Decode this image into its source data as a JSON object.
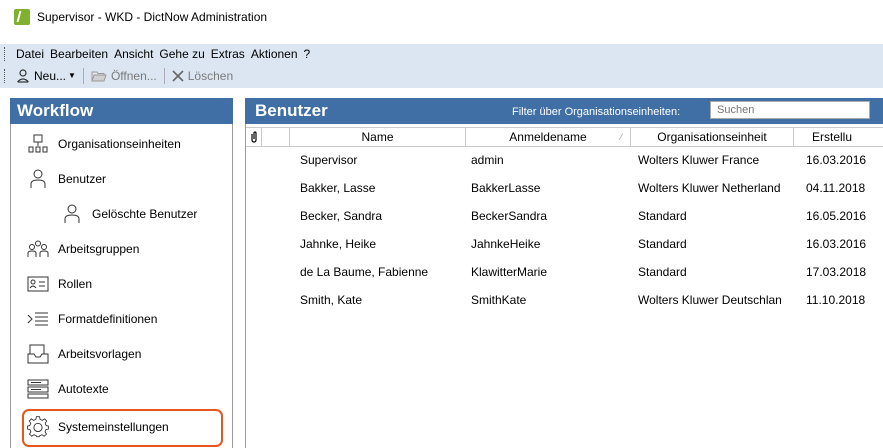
{
  "window": {
    "title": "Supervisor - WKD - DictNow Administration"
  },
  "menu": [
    "Datei",
    "Bearbeiten",
    "Ansicht",
    "Gehe zu",
    "Extras",
    "Aktionen",
    "?"
  ],
  "toolbar": {
    "new_label": "Neu...",
    "open_label": "Öffnen...",
    "delete_label": "Löschen"
  },
  "sidebar": {
    "title": "Workflow",
    "items": [
      {
        "label": "Organisationseinheiten",
        "icon": "org-units-icon"
      },
      {
        "label": "Benutzer",
        "icon": "user-icon"
      },
      {
        "label": "Gelöschte Benutzer",
        "icon": "deleted-user-icon"
      },
      {
        "label": "Arbeitsgruppen",
        "icon": "workgroups-icon"
      },
      {
        "label": "Rollen",
        "icon": "roles-icon"
      },
      {
        "label": "Formatdefinitionen",
        "icon": "format-definitions-icon"
      },
      {
        "label": "Arbeitsvorlagen",
        "icon": "work-templates-icon"
      },
      {
        "label": "Autotexte",
        "icon": "autotext-icon"
      },
      {
        "label": "Systemeinstellungen",
        "icon": "gear-icon"
      }
    ],
    "highlight_color": "#e8551f"
  },
  "main": {
    "title": "Benutzer",
    "filter_label": "Filter über Organisationseinheiten:",
    "search_placeholder": "Suchen",
    "columns": [
      "Name",
      "Anmeldename",
      "Organisationseinheit",
      "Erstellu"
    ],
    "rows": [
      {
        "name": "Supervisor",
        "login": "admin",
        "org": "Wolters Kluwer France",
        "created": "16.03.2016"
      },
      {
        "name": "Bakker, Lasse",
        "login": "BakkerLasse",
        "org": "Wolters Kluwer Netherland",
        "created": "04.11.2018"
      },
      {
        "name": "Becker, Sandra",
        "login": "BeckerSandra",
        "org": "Standard",
        "created": "16.05.2016"
      },
      {
        "name": "Jahnke, Heike",
        "login": "JahnkeHeike",
        "org": "Standard",
        "created": "16.03.2016"
      },
      {
        "name": "de La Baume, Fabienne",
        "login": "KlawitterMarie",
        "org": "Standard",
        "created": "17.03.2018"
      },
      {
        "name": "Smith, Kate",
        "login": "SmithKate",
        "org": "Wolters Kluwer Deutschlan",
        "created": "11.10.2018"
      }
    ]
  },
  "colors": {
    "header_blue": "#3f6fa4",
    "toolbar_bg": "#dce6f2"
  }
}
